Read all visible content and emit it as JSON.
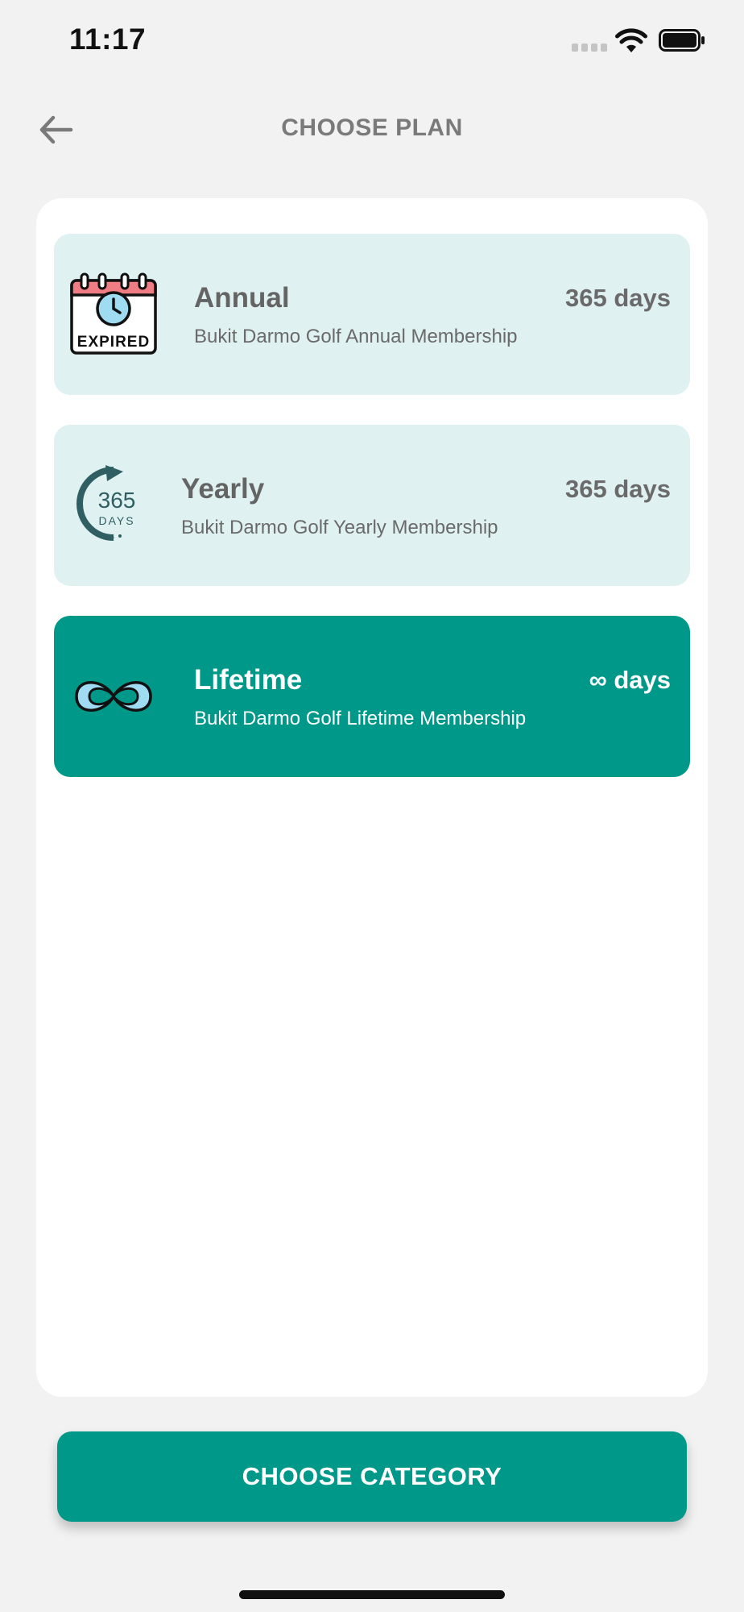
{
  "status_bar": {
    "time": "11:17"
  },
  "header": {
    "title": "CHOOSE PLAN"
  },
  "plans": [
    {
      "name": "Annual",
      "description": "Bukit Darmo Golf Annual Membership",
      "duration": "365 days",
      "icon": "expired-calendar-icon",
      "selected": false
    },
    {
      "name": "Yearly",
      "description": "Bukit Darmo Golf Yearly Membership",
      "duration": "365 days",
      "icon": "365-days-icon",
      "selected": false,
      "icon_text": {
        "number": "365",
        "unit": "DAYS"
      }
    },
    {
      "name": "Lifetime",
      "description": "Bukit Darmo Golf Lifetime Membership",
      "duration": "∞ days",
      "icon": "infinity-icon",
      "selected": true
    }
  ],
  "icon_labels": {
    "expired": "EXPIRED"
  },
  "cta": {
    "label": "CHOOSE CATEGORY"
  },
  "colors": {
    "accent": "#009888",
    "card_unselected": "#e0f1f1",
    "background": "#f2f2f2"
  }
}
